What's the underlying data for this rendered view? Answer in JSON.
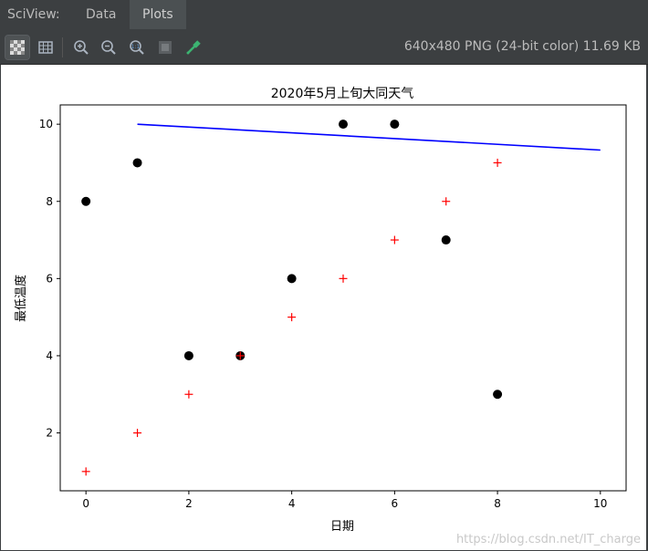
{
  "app": {
    "label": "SciView:",
    "tabs": [
      {
        "label": "Data",
        "active": false
      },
      {
        "label": "Plots",
        "active": true
      }
    ],
    "image_info": "640x480 PNG (24-bit color) 11.69 KB"
  },
  "toolbar": {
    "tools": [
      {
        "name": "checkerboard-background-icon",
        "active": true
      },
      {
        "name": "grid-view-icon",
        "active": false
      },
      {
        "name": "zoom-in-icon",
        "active": false
      },
      {
        "name": "zoom-out-icon",
        "active": false
      },
      {
        "name": "actual-size-icon",
        "active": false
      },
      {
        "name": "fit-icon",
        "active": false
      },
      {
        "name": "color-picker-icon",
        "active": false
      }
    ]
  },
  "watermark": "https://blog.csdn.net/IT_charge",
  "chart_data": {
    "type": "scatter",
    "title": "2020年5月上旬大同天气",
    "xlabel": "日期",
    "ylabel": "最低温度",
    "xlim": [
      -0.5,
      10.5
    ],
    "ylim": [
      0.5,
      10.5
    ],
    "xticks": [
      0,
      2,
      4,
      6,
      8,
      10
    ],
    "yticks": [
      2,
      4,
      6,
      8,
      10
    ],
    "grid": false,
    "series": [
      {
        "type": "scatter",
        "marker": "circle",
        "color": "#000000",
        "x": [
          0,
          1,
          2,
          3,
          4,
          5,
          6,
          7,
          8
        ],
        "y": [
          8,
          9,
          4,
          4,
          6,
          10,
          10,
          7,
          3
        ]
      },
      {
        "type": "scatter",
        "marker": "plus",
        "color": "#ff0000",
        "x": [
          0,
          1,
          2,
          3,
          4,
          5,
          6,
          7,
          8
        ],
        "y": [
          1,
          2,
          3,
          4,
          5,
          6,
          7,
          8,
          9
        ]
      },
      {
        "type": "line",
        "color": "#0000ff",
        "x": [
          1,
          10
        ],
        "y": [
          10,
          9.33
        ]
      }
    ]
  }
}
